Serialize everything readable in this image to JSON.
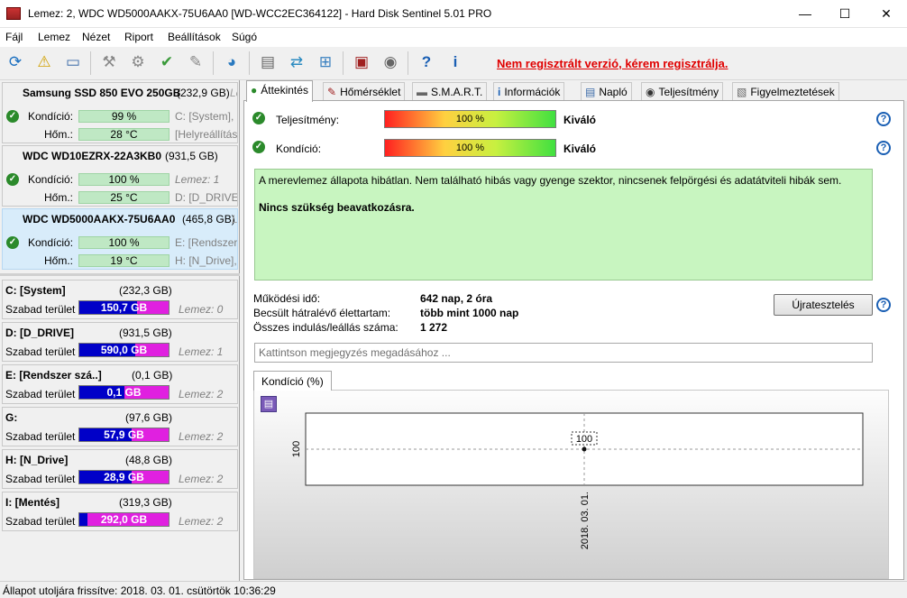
{
  "window": {
    "title": "Lemez: 2, WDC WD5000AAKX-75U6AA0 [WD-WCC2EC364122]  -  Hard Disk Sentinel 5.01 PRO",
    "minimize": "—",
    "maximize": "☐",
    "close": "✕"
  },
  "menu": [
    "Fájl",
    "Lemez",
    "Nézet",
    "Riport",
    "Beállítások",
    "Súgó"
  ],
  "toolbar": {
    "register_link": "Nem regisztrált verzió, kérem regisztrálja."
  },
  "disks": [
    {
      "name": "Samsung SSD 850 EVO 250GB",
      "capacity": "(232,9 GB)",
      "cut": "Le",
      "cond_label": "Kondíció:",
      "cond_value": "99 %",
      "temp_label": "Hőm.:",
      "temp_value": "28 °C",
      "vol1": "C: [System],",
      "vol2": "[Helyreállítás"
    },
    {
      "name": "WDC WD10EZRX-22A3KB0",
      "capacity": "(931,5 GB)",
      "cut": "",
      "cond_label": "Kondíció:",
      "cond_value": "100 %",
      "temp_label": "Hőm.:",
      "temp_value": "25 °C",
      "vol1": "Lemez: 1",
      "vol2": "D: [D_DRIVE]"
    },
    {
      "name": "WDC WD5000AAKX-75U6AA0",
      "capacity": "(465,8 GB)",
      "cut": "Le",
      "cond_label": "Kondíció:",
      "cond_value": "100 %",
      "temp_label": "Hőm.:",
      "temp_value": "19 °C",
      "vol1": "E: [Rendszer s",
      "vol2": "H: [N_Drive],"
    }
  ],
  "partitions": [
    {
      "name": "C: [System]",
      "size": "(232,3 GB)",
      "free_label": "Szabad terület",
      "free": "150,7 GB",
      "fill": 0.65,
      "disk": "Lemez: 0"
    },
    {
      "name": "D: [D_DRIVE]",
      "size": "(931,5 GB)",
      "free_label": "Szabad terület",
      "free": "590,0 GB",
      "fill": 0.63,
      "disk": "Lemez: 1"
    },
    {
      "name": "E: [Rendszer szá..]",
      "size": "(0,1 GB)",
      "free_label": "Szabad terület",
      "free": "0,1 GB",
      "fill": 0.5,
      "disk": "Lemez: 2"
    },
    {
      "name": "G:",
      "size": "(97,6 GB)",
      "free_label": "Szabad terület",
      "free": "57,9 GB",
      "fill": 0.59,
      "disk": "Lemez: 2"
    },
    {
      "name": "H: [N_Drive]",
      "size": "(48,8 GB)",
      "free_label": "Szabad terület",
      "free": "28,9 GB",
      "fill": 0.59,
      "disk": "Lemez: 2"
    },
    {
      "name": "I: [Mentés]",
      "size": "(319,3 GB)",
      "free_label": "Szabad terület",
      "free": "292,0 GB",
      "fill": 0.09,
      "disk": "Lemez: 2"
    }
  ],
  "tabs": [
    "Áttekintés",
    "Hőmérséklet",
    "S.M.A.R.T.",
    "Információk",
    "Napló",
    "Teljesítmény",
    "Figyelmeztetések"
  ],
  "overview": {
    "perf_label": "Teljesítmény:",
    "perf_value": "100 %",
    "perf_rating": "Kiváló",
    "cond_label": "Kondíció:",
    "cond_value": "100 %",
    "cond_rating": "Kiváló",
    "message": "A merevlemez állapota hibátlan. Nem található hibás vagy gyenge szektor, nincsenek felpörgési és adatátviteli hibák sem.",
    "action": "Nincs szükség beavatkozásra.",
    "uptime_label": "Működési idő:",
    "uptime_value": "642 nap, 2 óra",
    "life_label": "Becsült hátralévő élettartam:",
    "life_value": "több mint 1000 nap",
    "starts_label": "Összes indulás/leállás száma:",
    "starts_value": "1 272",
    "restart_label": "Újratesztelés",
    "note_placeholder": "Kattintson megjegyzés megadásához ..."
  },
  "graph": {
    "tab_label": "Kondíció  (%)",
    "y_tick": "100",
    "point_label": "100",
    "x_tick": "2018. 03. 01."
  },
  "chart_data": {
    "type": "line",
    "x": [
      "2018. 03. 01."
    ],
    "series": [
      {
        "values": [
          100
        ]
      }
    ],
    "ylabel": "",
    "xlabel": ""
  },
  "status": "Állapot utoljára frissítve: 2018. 03. 01. csütörtök 10:36:29"
}
